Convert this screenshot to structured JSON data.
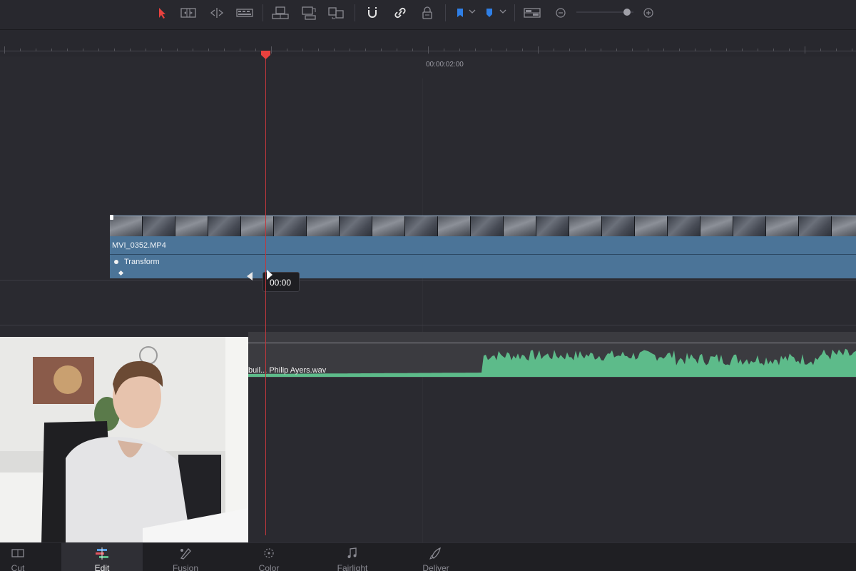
{
  "toolbar": {
    "tools": [
      {
        "name": "selection-mode",
        "icon": "arrow-pointer-icon",
        "active": true
      },
      {
        "name": "trim-edit-mode",
        "icon": "trim-icon"
      },
      {
        "name": "dynamic-trim-mode",
        "icon": "dynamic-trim-icon"
      },
      {
        "name": "blade-edit-mode",
        "icon": "blade-icon"
      },
      {
        "name": "insert-clip",
        "icon": "insert-clip-icon"
      },
      {
        "name": "overwrite-clip",
        "icon": "overwrite-clip-icon"
      },
      {
        "name": "replace-clip",
        "icon": "replace-clip-icon"
      },
      {
        "name": "snapping",
        "icon": "magnet-icon"
      },
      {
        "name": "linked-selection",
        "icon": "link-icon"
      },
      {
        "name": "position-lock",
        "icon": "lock-icon"
      },
      {
        "name": "flag",
        "icon": "flag-icon"
      },
      {
        "name": "marker",
        "icon": "marker-icon"
      },
      {
        "name": "timeline-view-options",
        "icon": "view-options-icon"
      },
      {
        "name": "zoom-out",
        "icon": "zoom-out-icon"
      },
      {
        "name": "zoom-in",
        "icon": "zoom-in-icon"
      }
    ],
    "accent_color": "#e8413e",
    "marker_color": "#2f7fe6",
    "zoom_level": 0.85
  },
  "ruler": {
    "timecode": "00:00:02:00"
  },
  "video_clip": {
    "name": "MVI_0352.MP4",
    "effect": "Transform",
    "color": "#4b7498"
  },
  "tooltip": {
    "text": "00:00"
  },
  "audio_clip": {
    "name": "buil... Philip Ayers.wav",
    "wave_color": "#5dbb8a"
  },
  "playhead_color": "#e8413e",
  "pages": [
    {
      "label": "Cut",
      "icon": "cut-page-icon",
      "active": false
    },
    {
      "label": "Edit",
      "icon": "edit-page-icon",
      "active": true
    },
    {
      "label": "Fusion",
      "icon": "fusion-page-icon",
      "active": false
    },
    {
      "label": "Color",
      "icon": "color-page-icon",
      "active": false
    },
    {
      "label": "Fairlight",
      "icon": "fairlight-page-icon",
      "active": false
    },
    {
      "label": "Deliver",
      "icon": "deliver-page-icon",
      "active": false
    }
  ]
}
